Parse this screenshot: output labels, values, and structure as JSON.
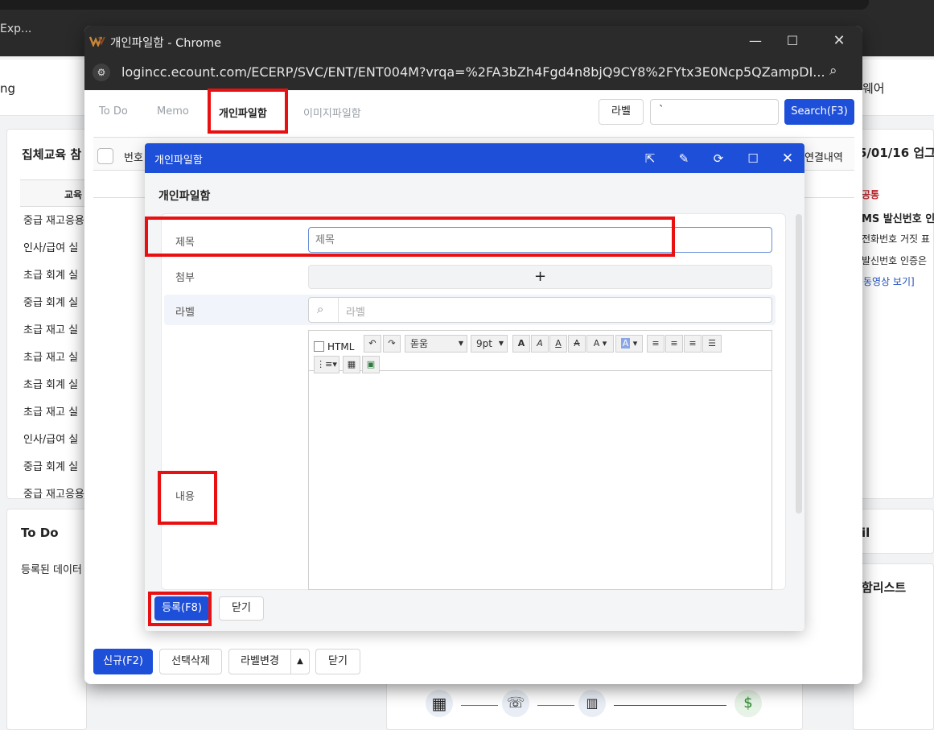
{
  "background": {
    "taskbar_text": "Exp...",
    "nav_left": "ng",
    "nav_right": "웨어",
    "left_card": {
      "title": "집체교육 참",
      "col_header": "교육",
      "rows": [
        "중급 재고응용",
        "인사/급여 실",
        "초급 회계 실",
        "중급 회계 실",
        "초급 재고 실",
        "초급 재고 실",
        "초급 회계 실",
        "초급 재고 실",
        "인사/급여 실",
        "중급 회계 실",
        "중급 재고응용"
      ]
    },
    "todo_card": {
      "title": "To Do",
      "empty": "등록된 데이터"
    },
    "right_card": {
      "title": "5/01/16 업그",
      "tag": "공통",
      "lines": [
        "MS 발신번호 인",
        "전화번호 거짓 표",
        "발신번호 인증은"
      ],
      "link": "동영상 보기]"
    },
    "right_card2": {
      "title": "il"
    },
    "right_card3": {
      "title": "함리스트"
    }
  },
  "window": {
    "title": "개인파일함 - Chrome",
    "url": "logincc.ecount.com/ECERP/SVC/ENT/ENT004M?vrqa=%2FA3bZh4Fgd4n8bjQ9CY8%2FYtx3E0Ncp5QZampDI..."
  },
  "tabs": [
    "To Do",
    "Memo",
    "개인파일함",
    "이미지파일함"
  ],
  "toolbar": {
    "label_button": "라벨",
    "search_value": "`",
    "search_button": "Search(F3)"
  },
  "grid": {
    "col_no": "번호",
    "col_link": "연결내역"
  },
  "modal": {
    "header": "개인파일함",
    "title": "개인파일함",
    "fields": {
      "subject_label": "제목",
      "subject_placeholder": "제목",
      "attach_label": "첨부",
      "attach_add": "+",
      "label_label": "라벨",
      "label_placeholder": "라벨",
      "content_label": "내용"
    },
    "editor": {
      "html_label": "HTML",
      "font": "돋움",
      "size": "9pt"
    },
    "register_button": "등록(F8)",
    "close_button": "닫기"
  },
  "footer": {
    "new_button": "신규(F2)",
    "delete_button": "선택삭제",
    "label_change_button": "라벨변경",
    "close_button": "닫기"
  },
  "colors": {
    "primary": "#1e4fd9",
    "highlight": "#e81010"
  }
}
